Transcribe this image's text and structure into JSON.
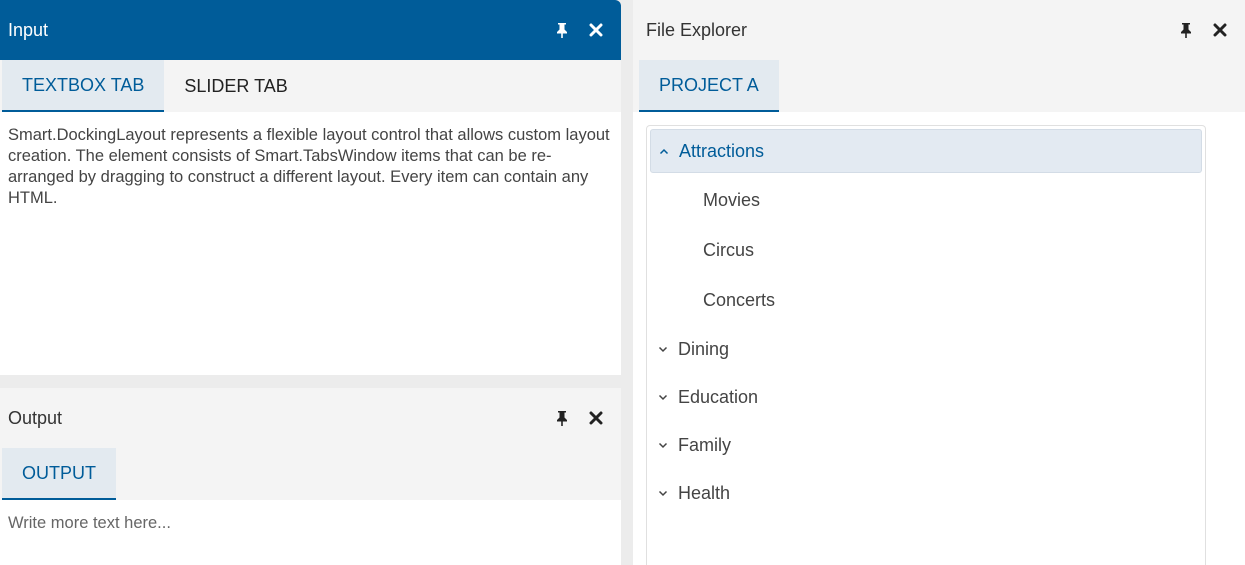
{
  "input_panel": {
    "title": "Input",
    "tabs": [
      {
        "label": "TEXTBOX TAB"
      },
      {
        "label": "SLIDER TAB"
      }
    ],
    "content_text": "Smart.DockingLayout represents a flexible layout control that allows custom layout creation. The element consists of Smart.TabsWindow items that can be re-arranged by dragging to construct a different layout. Every item can contain any HTML."
  },
  "output_panel": {
    "title": "Output",
    "tabs": [
      {
        "label": "OUTPUT"
      }
    ],
    "placeholder": "Write more text here..."
  },
  "explorer_panel": {
    "title": "File Explorer",
    "tabs": [
      {
        "label": "PROJECT A"
      }
    ],
    "tree": [
      {
        "label": "Attractions",
        "expanded": true,
        "children": [
          "Movies",
          "Circus",
          "Concerts"
        ]
      },
      {
        "label": "Dining",
        "expanded": false
      },
      {
        "label": "Education",
        "expanded": false
      },
      {
        "label": "Family",
        "expanded": false
      },
      {
        "label": "Health",
        "expanded": false
      }
    ]
  },
  "icons": {
    "pin": "pin-icon",
    "close": "close-icon",
    "chevron_up": "chevron-up-icon",
    "chevron_down": "chevron-down-icon"
  },
  "colors": {
    "accent": "#005c99",
    "selected_bg": "#e3eaf0"
  }
}
